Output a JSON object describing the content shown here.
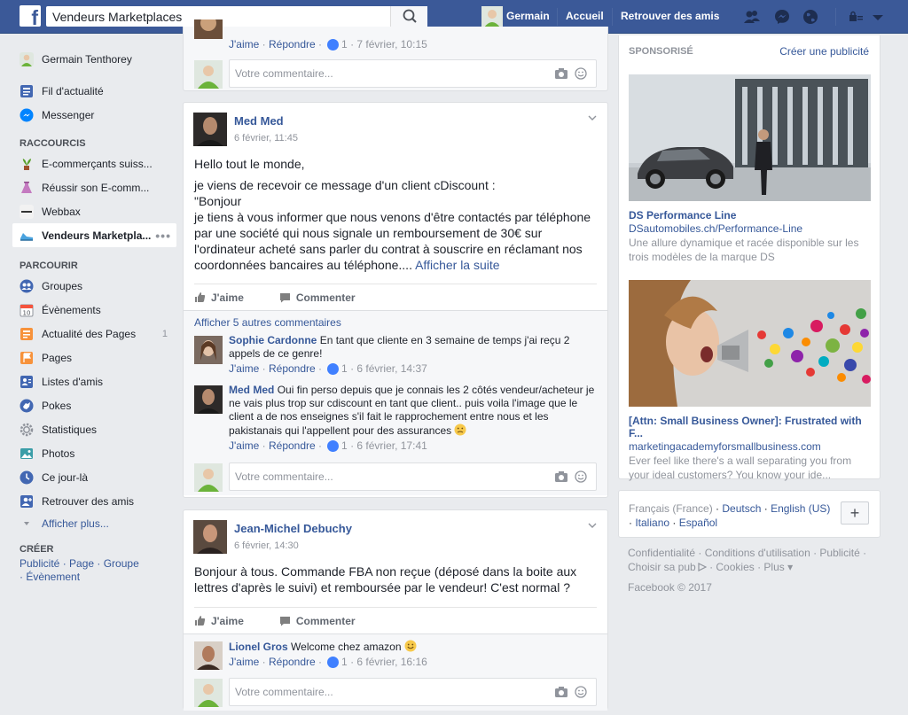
{
  "topbar": {
    "search_value": "Vendeurs Marketplaces",
    "user_name": "Germain",
    "home": "Accueil",
    "find_friends": "Retrouver des amis"
  },
  "left": {
    "user": "Germain Tenthorey",
    "news_feed": "Fil d'actualité",
    "messenger": "Messenger",
    "shortcuts_title": "RACCOURCIS",
    "shortcuts": [
      {
        "label": "E-commerçants suiss..."
      },
      {
        "label": "Réussir son E-comm..."
      },
      {
        "label": "Webbax"
      },
      {
        "label": "Vendeurs Marketpla...",
        "active": true
      }
    ],
    "explore_title": "PARCOURIR",
    "explore": [
      {
        "label": "Groupes",
        "icon": "groups-icon",
        "color": "#4267b2"
      },
      {
        "label": "Évènements",
        "icon": "calendar-icon",
        "color": "#f5533d"
      },
      {
        "label": "Actualité des Pages",
        "icon": "pages-feed-icon",
        "color": "#f7923b",
        "count": "1"
      },
      {
        "label": "Pages",
        "icon": "flag-icon",
        "color": "#f7923b"
      },
      {
        "label": "Listes d'amis",
        "icon": "friend-lists-icon",
        "color": "#4267b2"
      },
      {
        "label": "Pokes",
        "icon": "poke-icon",
        "color": "#4267b2"
      },
      {
        "label": "Statistiques",
        "icon": "gear-icon",
        "color": "#90949c"
      },
      {
        "label": "Photos",
        "icon": "photos-icon",
        "color": "#3b9ea8"
      },
      {
        "label": "Ce jour-là",
        "icon": "clock-icon",
        "color": "#4267b2"
      },
      {
        "label": "Retrouver des amis",
        "icon": "find-friends-icon",
        "color": "#4267b2"
      }
    ],
    "see_more": "Afficher plus...",
    "create_title": "CRÉER",
    "create_links": "Publicité · Page · Groupe · Évènement"
  },
  "feed": {
    "top_comment_meta": {
      "like": "J'aime",
      "reply": "Répondre",
      "count": "1",
      "time": "7 février, 10:15"
    },
    "comment_placeholder": "Votre commentaire...",
    "like_label": "J'aime",
    "comment_label": "Commenter",
    "posts": [
      {
        "author": "Med Med",
        "time": "6 février, 11:45",
        "text_lines": [
          "Hello tout le monde,",
          "",
          "je viens de recevoir ce message d'un client cDiscount :",
          "\"Bonjour",
          "je tiens à vous informer que nous venons d'être contactés par téléphone",
          "par une société qui nous signale un remboursement de 30€ sur",
          "l'ordinateur acheté sans parler du contrat à souscrire en réclamant nos",
          "coordonnées bancaires au téléphone...."
        ],
        "see_more": "Afficher la suite",
        "more_comments": "Afficher 5 autres commentaires",
        "comments": [
          {
            "name": "Sophie Cardonne",
            "text": "En tant que cliente en 3 semaine de temps j'ai reçu 2 appels de ce genre!",
            "count": "1",
            "time": "6 février, 14:37"
          },
          {
            "name": "Med Med",
            "text": "Oui fin perso depuis que je connais les 2 côtés vendeur/acheteur je ne vais plus trop sur cdiscount en tant que client.. puis voila l'image que le client a de nos enseignes s'il fait le rapprochement entre nous et les pakistanais qui l'appellent pour des assurances",
            "count": "1",
            "time": "6 février, 17:41"
          }
        ]
      },
      {
        "author": "Jean-Michel Debuchy",
        "time": "6 février, 14:30",
        "text_lines": [
          "Bonjour à tous. Commande FBA non reçue (déposé dans la boite aux",
          "lettres d'après le suivi) et remboursée par le vendeur! C'est normal ?"
        ],
        "comments": [
          {
            "name": "Lionel Gros",
            "text": "Welcome chez amazon",
            "count": "1",
            "time": "6 février, 16:16"
          }
        ]
      }
    ]
  },
  "right": {
    "sponsored": "SPONSORISÉ",
    "create_ad": "Créer une publicité",
    "ads": [
      {
        "title": "DS Performance Line",
        "url": "DSautomobiles.ch/Performance-Line",
        "desc": "Une allure dynamique et racée disponible sur les trois modèles de la marque DS"
      },
      {
        "title": "[Attn: Small Business Owner]: Frustrated with F...",
        "url": "marketingacademyforsmallbusiness.com",
        "desc": "Ever feel like there's a wall separating you from your ideal customers? You know your ide..."
      }
    ],
    "languages": {
      "current": "Français (France)",
      "others": [
        "Deutsch",
        "English (US)",
        "Italiano",
        "Español"
      ]
    },
    "footer_line1": "Confidentialité · Conditions d'utilisation · Publicité ·",
    "footer_line2": "Choisir sa pub",
    "footer_line2b": "· Cookies · Plus ▾",
    "copyright": "Facebook © 2017"
  }
}
